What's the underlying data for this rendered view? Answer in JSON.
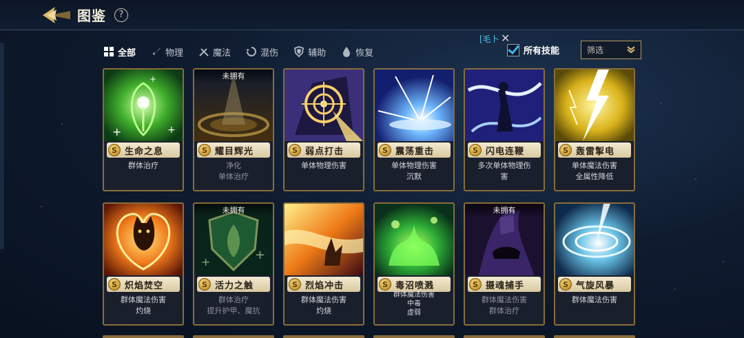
{
  "header": {
    "title": "图鉴",
    "help_icon": "?"
  },
  "filters": [
    {
      "label": "全部",
      "icon": "grid-icon",
      "active": true
    },
    {
      "label": "物理",
      "icon": "sword-icon",
      "active": false
    },
    {
      "label": "魔法",
      "icon": "magic-icon",
      "active": false
    },
    {
      "label": "混伤",
      "icon": "swirl-icon",
      "active": false
    },
    {
      "label": "辅助",
      "icon": "shield-icon",
      "active": false
    },
    {
      "label": "恢复",
      "icon": "drop-icon",
      "active": false
    }
  ],
  "overlay_hint": "[毛卜",
  "owned_toggle": {
    "label": "所有技能",
    "checked": true
  },
  "sort_select": {
    "value": "筛选"
  },
  "unowned_label": "未拥有",
  "skills": [
    {
      "name": "生命之息",
      "rank": "S",
      "desc": [
        "群体治疗"
      ],
      "owned": true,
      "art": "green"
    },
    {
      "name": "耀目辉光",
      "rank": "S",
      "desc": [
        "净化",
        "单体治疗"
      ],
      "owned": false,
      "art": "gold-ring"
    },
    {
      "name": "弱点打击",
      "rank": "S",
      "desc": [
        "单体物理伤害"
      ],
      "owned": true,
      "art": "target"
    },
    {
      "name": "震荡重击",
      "rank": "S",
      "desc": [
        "单体物理伤害",
        "沉默"
      ],
      "owned": true,
      "art": "blue-burst"
    },
    {
      "name": "闪电连鞭",
      "rank": "S",
      "desc": [
        "多次单体物理伤",
        "害"
      ],
      "owned": true,
      "art": "lightning-whip"
    },
    {
      "name": "轰雷掣电",
      "rank": "S",
      "desc": [
        "单体魔法伤害",
        "全属性降低"
      ],
      "owned": true,
      "art": "yellow-bolt"
    },
    {
      "name": "炽焰焚空",
      "rank": "S",
      "desc": [
        "群体魔法伤害",
        "灼烧"
      ],
      "owned": true,
      "art": "fire-cat"
    },
    {
      "name": "活力之触",
      "rank": "S",
      "desc": [
        "群体治疗",
        "提升护甲、魔抗"
      ],
      "owned": false,
      "art": "green-shield"
    },
    {
      "name": "烈焰冲击",
      "rank": "S",
      "desc": [
        "群体魔法伤害",
        "灼烧"
      ],
      "owned": true,
      "art": "flame-wave"
    },
    {
      "name": "毒沼喷溅",
      "rank": "S",
      "desc": [
        "群体魔法伤害",
        "中毒",
        "虚弱"
      ],
      "owned": true,
      "art": "poison"
    },
    {
      "name": "摄魂捕手",
      "rank": "S",
      "desc": [
        "群体魔法伤害",
        "群体治疗"
      ],
      "owned": false,
      "art": "dark-hand"
    },
    {
      "name": "气旋风暴",
      "rank": "S",
      "desc": [
        "群体魔法伤害"
      ],
      "owned": true,
      "art": "cyclone"
    }
  ]
}
